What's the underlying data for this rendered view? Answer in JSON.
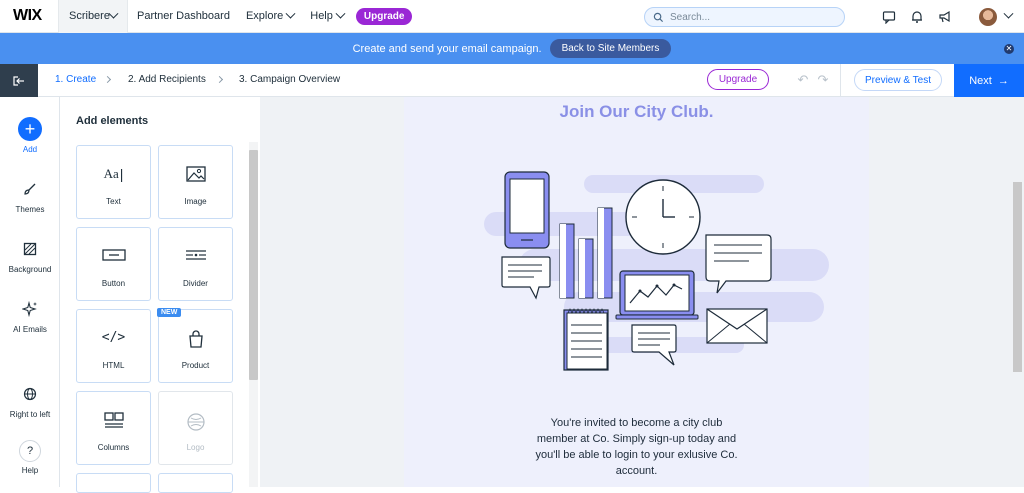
{
  "topbar": {
    "logo": "WIX",
    "site_selector": "Scribere",
    "nav": [
      "Partner Dashboard",
      "Explore",
      "Help"
    ],
    "upgrade": "Upgrade",
    "search_placeholder": "Search..."
  },
  "banner": {
    "text": "Create and send your email campaign.",
    "back_button": "Back to Site Members"
  },
  "stepbar": {
    "steps": [
      "1. Create",
      "2. Add Recipients",
      "3. Campaign Overview"
    ],
    "upgrade": "Upgrade",
    "preview": "Preview & Test",
    "next": "Next"
  },
  "rail": {
    "items": [
      "Add",
      "Themes",
      "Background",
      "AI Emails",
      "Right to left",
      "Help"
    ]
  },
  "panel": {
    "title": "Add elements",
    "tiles": [
      "Text",
      "Image",
      "Button",
      "Divider",
      "HTML",
      "Product",
      "Columns",
      "Logo"
    ],
    "new_tag": "NEW",
    "text_glyph": "Aa"
  },
  "email": {
    "title": "Join Our City Club.",
    "body": "You're invited to become a city club member at Co. Simply sign-up today and you'll be able to login to your exlusive Co. account."
  },
  "colors": {
    "accent": "#116dff",
    "banner": "#4a90f0",
    "upgrade": "#9a27d5",
    "email_title": "#8a90e6",
    "illustration": "#8a8ef0"
  }
}
